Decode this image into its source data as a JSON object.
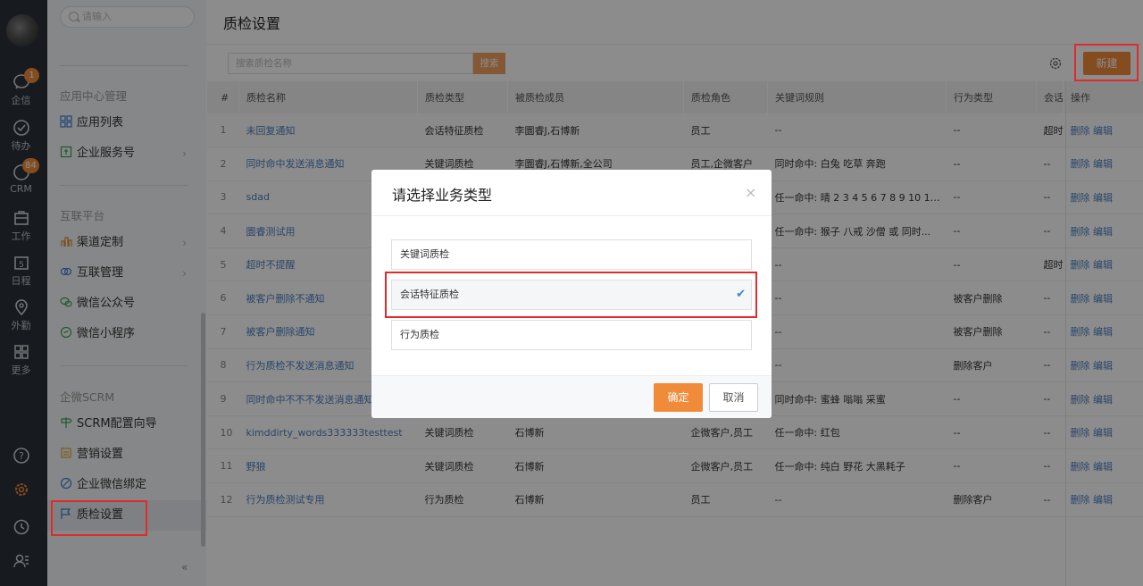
{
  "rail": {
    "items": [
      {
        "label": "企信",
        "badge": "1"
      },
      {
        "label": "待办",
        "badge": ""
      },
      {
        "label": "CRM",
        "badge": "84"
      },
      {
        "label": "工作",
        "badge": ""
      },
      {
        "label": "日程",
        "badge": ""
      },
      {
        "label": "外勤",
        "badge": ""
      },
      {
        "label": "更多",
        "badge": ""
      }
    ],
    "calendar_day": "5"
  },
  "sidebar": {
    "search_placeholder": "请输入",
    "sections": [
      {
        "title": "应用中心管理",
        "items": [
          "应用列表",
          "企业服务号"
        ]
      },
      {
        "title": "互联平台",
        "items": [
          "渠道定制",
          "互联管理",
          "微信公众号",
          "微信小程序"
        ]
      },
      {
        "title": "企微SCRM",
        "items": [
          "SCRM配置向导",
          "营销设置",
          "企业微信绑定",
          "质检设置"
        ]
      }
    ],
    "collapse": "«"
  },
  "main": {
    "title": "质检设置",
    "search_placeholder": "搜索质检名称",
    "search_button": "搜索",
    "new_button": "新建",
    "columns": [
      "#",
      "质检名称",
      "质检类型",
      "被质检成员",
      "质检角色",
      "关键词规则",
      "行为类型",
      "会话",
      "操作"
    ],
    "rows": [
      [
        "1",
        "未回复通知",
        "会话特征质检",
        "李圜睿J,石博新",
        "员工",
        "--",
        "--",
        "超时",
        "删除 编辑"
      ],
      [
        "2",
        "同时命中发送消息通知",
        "关键词质检",
        "李圜睿J,石博新,全公司",
        "员工,企微客户",
        "同时命中: 白兔 吃草 奔跑",
        "--",
        "--",
        "删除 编辑"
      ],
      [
        "3",
        "sdad",
        "",
        "",
        "",
        "任一命中: 晴 2 3 4 5 6 7 8 9 10 11 ...",
        "--",
        "--",
        "删除 编辑"
      ],
      [
        "4",
        "圜睿测试用",
        "",
        "",
        "",
        "任一命中: 猴子 八戒 沙僧 或 同时...",
        "--",
        "--",
        "删除 编辑"
      ],
      [
        "5",
        "超时不提醒",
        "",
        "",
        "",
        "--",
        "--",
        "超时",
        "删除 编辑"
      ],
      [
        "6",
        "被客户删除不通知",
        "",
        "",
        "",
        "--",
        "被客户删除",
        "--",
        "删除 编辑"
      ],
      [
        "7",
        "被客户删除通知",
        "",
        "",
        "",
        "--",
        "被客户删除",
        "--",
        "删除 编辑"
      ],
      [
        "8",
        "行为质检不发送消息通知",
        "",
        "",
        "",
        "--",
        "删除客户",
        "--",
        "删除 编辑"
      ],
      [
        "9",
        "同时命中不不不发送消息通知",
        "",
        "",
        "",
        "同时命中: 蜜蜂 嗡嗡 采蜜",
        "--",
        "--",
        "删除 编辑"
      ],
      [
        "10",
        "kimddirty_words333333testtest",
        "关键词质检",
        "石博新",
        "企微客户,员工",
        "任一命中: 红包",
        "--",
        "--",
        "删除 编辑"
      ],
      [
        "11",
        "野狼",
        "关键词质检",
        "石博新",
        "企微客户,员工",
        "任一命中: 纯白 野花 大黑耗子",
        "--",
        "--",
        "删除 编辑"
      ],
      [
        "12",
        "行为质检测试专用",
        "行为质检",
        "石博新",
        "员工",
        "--",
        "删除客户",
        "--",
        "删除 编辑"
      ]
    ]
  },
  "dialog": {
    "title": "请选择业务类型",
    "close": "×",
    "options": [
      "关键词质检",
      "会话特征质检",
      "行为质检"
    ],
    "selected_index": 1,
    "check": "✔",
    "ok": "确定",
    "cancel": "取消"
  },
  "colors": {
    "accent": "#f08b3a",
    "link": "#4a7fc1",
    "highlight": "#e02b2b"
  }
}
